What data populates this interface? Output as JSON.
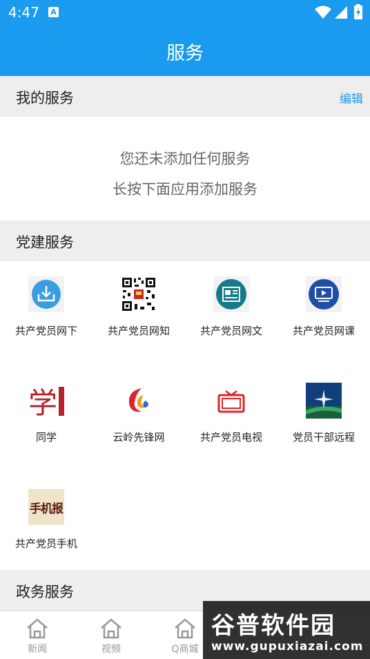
{
  "status_bar": {
    "time": "4:47",
    "badge": "A"
  },
  "header": {
    "title": "服务"
  },
  "my_services": {
    "title": "我的服务",
    "edit_label": "编辑",
    "empty_line1": "您还未添加任何服务",
    "empty_line2": "长按下面应用添加服务"
  },
  "party_services": {
    "title": "党建服务",
    "items": [
      {
        "label": "共产党员网下",
        "icon": "download-tray-icon"
      },
      {
        "label": "共产党员网知",
        "icon": "qr-code-icon"
      },
      {
        "label": "共产党员网文",
        "icon": "article-icon"
      },
      {
        "label": "共产党员网课",
        "icon": "video-play-icon"
      },
      {
        "label": "同学",
        "icon": "xue-logo-icon"
      },
      {
        "label": "云岭先锋网",
        "icon": "yunling-logo-icon"
      },
      {
        "label": "共产党员电视",
        "icon": "tv-icon"
      },
      {
        "label": "党员干部远程",
        "icon": "star-landscape-icon"
      },
      {
        "label": "共产党员手机",
        "icon": "mobile-newspaper-icon",
        "icon_text": "手机报"
      }
    ]
  },
  "gov_services": {
    "title": "政务服务"
  },
  "bottom_nav": [
    {
      "label": "新闻",
      "icon": "home-icon"
    },
    {
      "label": "视频",
      "icon": "home-icon"
    },
    {
      "label": "Q商城",
      "icon": "home-icon"
    }
  ],
  "watermark": {
    "line1": "谷普软件园",
    "line2": "www.gupuxiazai.com"
  },
  "colors": {
    "accent": "#1a9bf0",
    "section_bg": "#eeeeee",
    "party_red": "#c8272d"
  }
}
